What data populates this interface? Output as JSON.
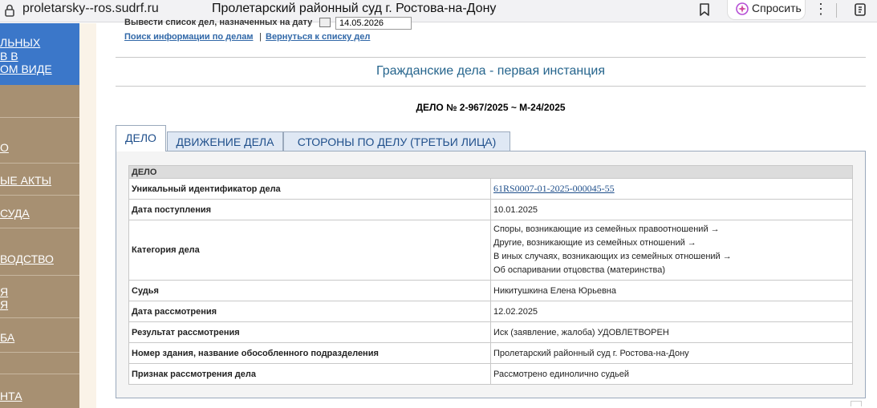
{
  "browser": {
    "url": "proletarsky--ros.sudrf.ru",
    "page_title": "Пролетарский районный суд г. Ростова-на-Дону",
    "ask_button_label": "Спросить",
    "more_label": "⋮"
  },
  "sidebar": {
    "blue_lines": [
      "ЛЬНЫХ",
      "В В",
      "ОМ ВИДЕ"
    ],
    "nav_items": [
      {
        "lines": [
          "О"
        ]
      },
      {
        "lines": [
          "ЫЕ АКТЫ"
        ]
      },
      {
        "lines": [
          "СУДА"
        ]
      },
      {
        "lines": [
          "ВОДСТВО"
        ]
      },
      {
        "lines": [
          "Я",
          "Я"
        ]
      },
      {
        "lines": [
          "БА"
        ]
      },
      {
        "lines": [
          "НТА"
        ]
      }
    ]
  },
  "filter": {
    "label": "Вывести список дел, назначенных на дату",
    "date_value": "14.05.2026",
    "search_link": "Поиск информации по делам",
    "separator": "|",
    "back_link": "Вернуться к списку дел"
  },
  "section_title": "Гражданские дела - первая инстанция",
  "case_number": "ДЕЛО № 2-967/2025 ~ М-24/2025",
  "tabs": [
    {
      "label": "ДЕЛО",
      "active": true
    },
    {
      "label": "ДВИЖЕНИЕ ДЕЛА",
      "active": false
    },
    {
      "label": "СТОРОНЫ ПО ДЕЛУ (ТРЕТЬИ ЛИЦА)",
      "active": false
    }
  ],
  "table": {
    "header": "ДЕЛО",
    "rows": [
      {
        "label": "Уникальный идентификатор дела",
        "value": "61RS0007-01-2025-000045-55"
      },
      {
        "label": "Дата поступления",
        "value": "10.01.2025"
      },
      {
        "label": "Категория дела",
        "lines": [
          "Споры, возникающие из семейных правоотношений →",
          "Другие, возникающие из семейных отношений →",
          "В иных случаях, возникающих из семейных отношений →",
          "Об оспаривании отцовства (материнства)"
        ]
      },
      {
        "label": "Судья",
        "value": "Никитушкина Елена Юрьевна"
      },
      {
        "label": "Дата рассмотрения",
        "value": "12.02.2025"
      },
      {
        "label": "Результат рассмотрения",
        "value": "Иск (заявление, жалоба) УДОВЛЕТВОРЕН"
      },
      {
        "label": "Номер здания, название обособленного подразделения",
        "value": "Пролетарский районный суд г. Ростова-на-Дону"
      },
      {
        "label": "Признак рассмотрения дела",
        "value": "Рассмотрено единолично судьей"
      }
    ]
  },
  "colors": {
    "sidebar_blue": "#3b77c9",
    "sidebar_brown": "#a79072",
    "title_teal": "#26658d",
    "link_blue": "#3168a8"
  },
  "icons": [
    "lock-icon",
    "bookmark-icon",
    "ai-sparkle-icon",
    "extension-icon",
    "calendar-icon"
  ]
}
